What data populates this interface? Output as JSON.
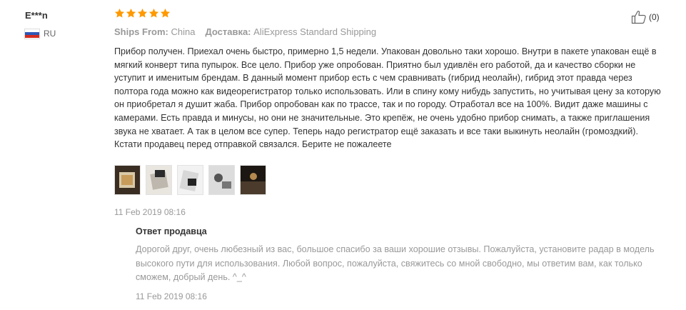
{
  "reviewer": {
    "name": "E***n",
    "country_code": "RU",
    "flag_colors": [
      "#ffffff",
      "#2e56b5",
      "#d52b1e"
    ]
  },
  "rating": {
    "stars": 5,
    "max": 5,
    "color": "#f90"
  },
  "meta": {
    "ships_from_label": "Ships From:",
    "ships_from_value": "China",
    "delivery_label": "Доставка:",
    "delivery_value": "AliExpress Standard Shipping"
  },
  "helpful": {
    "icon": "thumbs-up-icon",
    "count": "(0)"
  },
  "review": {
    "text": "Прибор получен. Приехал очень быстро, примерно 1,5 недели. Упакован довольно таки хорошо. Внутри в пакете упакован ещё в мягкий конверт типа пупырок. Все цело. Прибор уже опробован. Приятно был удивлён его работой, да и качество сборки не уступит и именитым брендам. В данный момент прибор есть с чем сравнивать (гибрид неолайн), гибрид этот правда через полтора года можно как видеорегистратор только использовать. Или в спину кому нибудь запустить, но учитывая цену за которую он приобретал я душит жаба. Прибор опробован как по трассе, так и по городу. Отработал все на 100%. Видит даже машины с камерами. Есть правда и минусы, но они не значительные. Это крепёж, не очень удобно прибор снимать, а также приглашения звука не хватает. А так в целом все супер. Теперь надо регистратор ещё заказать и все таки выкинуть неолайн (громоздкий). Кстати продавец перед отправкой связался. Берите не пожалеете",
    "date": "11 Feb 2019 08:16",
    "photos": [
      "photo-1",
      "photo-2",
      "photo-3",
      "photo-4",
      "photo-5"
    ]
  },
  "seller_reply": {
    "title": "Ответ продавца",
    "text": "Дорогой друг, очень любезный из вас, большое спасибо за ваши хорошие отзывы. Пожалуйста, установите радар в модель высокого пути для использования. Любой вопрос, пожалуйста, свяжитесь со мной свободно, мы ответим вам, как только сможем, добрый день. ^_^",
    "date": "11 Feb 2019 08:16"
  }
}
